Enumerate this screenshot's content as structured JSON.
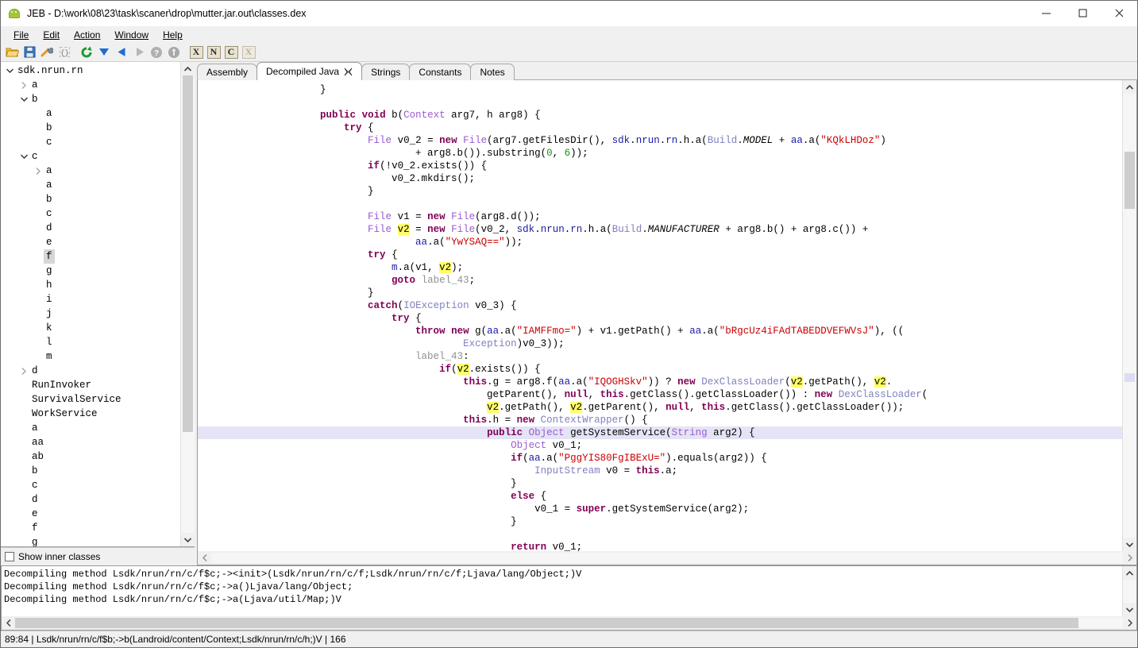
{
  "window": {
    "title": "JEB - D:\\work\\08\\23\\task\\scaner\\drop\\mutter.jar.out\\classes.dex",
    "icon": "android-robot-icon",
    "minimize": "—",
    "maximize": "□",
    "close": "✕"
  },
  "menu": [
    {
      "label": "File"
    },
    {
      "label": "Edit"
    },
    {
      "label": "Action"
    },
    {
      "label": "Window"
    },
    {
      "label": "Help"
    }
  ],
  "toolbar": {
    "buttons": [
      {
        "name": "open-folder-icon",
        "tip": "Open"
      },
      {
        "name": "save-icon",
        "tip": "Save"
      },
      {
        "name": "wrench-icon",
        "tip": "Options"
      },
      {
        "name": "braces-icon",
        "tip": "Decompile"
      },
      {
        "name": "refresh-icon",
        "tip": "Refresh"
      },
      {
        "name": "down-arrow-icon",
        "tip": "Forward"
      },
      {
        "name": "left-arrow-icon",
        "tip": "Back"
      },
      {
        "name": "right-arrow-icon",
        "tip": "Next"
      },
      {
        "name": "help-icon",
        "tip": "Help"
      },
      {
        "name": "info-icon",
        "tip": "About"
      }
    ],
    "letter_buttons": [
      {
        "label": "X",
        "disabled": false
      },
      {
        "label": "N",
        "disabled": false
      },
      {
        "label": "C",
        "disabled": false
      },
      {
        "label": "X",
        "disabled": true
      }
    ]
  },
  "tree": {
    "root": "sdk.nrun.rn",
    "selected": "f",
    "items": [
      {
        "label": "sdk.nrun.rn",
        "depth": 0,
        "twisty": "down"
      },
      {
        "label": "a",
        "depth": 1,
        "twisty": "right"
      },
      {
        "label": "b",
        "depth": 1,
        "twisty": "down"
      },
      {
        "label": "a",
        "depth": 2,
        "twisty": "none"
      },
      {
        "label": "b",
        "depth": 2,
        "twisty": "none"
      },
      {
        "label": "c",
        "depth": 2,
        "twisty": "none"
      },
      {
        "label": "c",
        "depth": 1,
        "twisty": "down"
      },
      {
        "label": "a",
        "depth": 2,
        "twisty": "right"
      },
      {
        "label": "a",
        "depth": 2,
        "twisty": "none"
      },
      {
        "label": "b",
        "depth": 2,
        "twisty": "none"
      },
      {
        "label": "c",
        "depth": 2,
        "twisty": "none"
      },
      {
        "label": "d",
        "depth": 2,
        "twisty": "none"
      },
      {
        "label": "e",
        "depth": 2,
        "twisty": "none"
      },
      {
        "label": "f",
        "depth": 2,
        "twisty": "none",
        "selected": true
      },
      {
        "label": "g",
        "depth": 2,
        "twisty": "none"
      },
      {
        "label": "h",
        "depth": 2,
        "twisty": "none"
      },
      {
        "label": "i",
        "depth": 2,
        "twisty": "none"
      },
      {
        "label": "j",
        "depth": 2,
        "twisty": "none"
      },
      {
        "label": "k",
        "depth": 2,
        "twisty": "none"
      },
      {
        "label": "l",
        "depth": 2,
        "twisty": "none"
      },
      {
        "label": "m",
        "depth": 2,
        "twisty": "none"
      },
      {
        "label": "d",
        "depth": 1,
        "twisty": "right"
      },
      {
        "label": "RunInvoker",
        "depth": 1,
        "twisty": "none"
      },
      {
        "label": "SurvivalService",
        "depth": 1,
        "twisty": "none"
      },
      {
        "label": "WorkService",
        "depth": 1,
        "twisty": "none"
      },
      {
        "label": "a",
        "depth": 1,
        "twisty": "none"
      },
      {
        "label": "aa",
        "depth": 1,
        "twisty": "none"
      },
      {
        "label": "ab",
        "depth": 1,
        "twisty": "none"
      },
      {
        "label": "b",
        "depth": 1,
        "twisty": "none"
      },
      {
        "label": "c",
        "depth": 1,
        "twisty": "none"
      },
      {
        "label": "d",
        "depth": 1,
        "twisty": "none"
      },
      {
        "label": "e",
        "depth": 1,
        "twisty": "none"
      },
      {
        "label": "f",
        "depth": 1,
        "twisty": "none"
      },
      {
        "label": "g",
        "depth": 1,
        "twisty": "none"
      }
    ],
    "show_inner_classes": {
      "label": "Show inner classes",
      "checked": false
    }
  },
  "tabs": [
    {
      "label": "Assembly",
      "active": false,
      "closable": false
    },
    {
      "label": "Decompiled Java",
      "active": true,
      "closable": true
    },
    {
      "label": "Strings",
      "active": false,
      "closable": false
    },
    {
      "label": "Constants",
      "active": false,
      "closable": false
    },
    {
      "label": "Notes",
      "active": false,
      "closable": false
    }
  ],
  "editor": {
    "highlighted_token": "v2",
    "highlighted_line_index": 27,
    "lines": [
      "                    }",
      "",
      "                    public void b(Context arg7, h arg8) {",
      "                        try {",
      "                            File v0_2 = new File(arg7.getFilesDir(), sdk.nrun.rn.h.a(Build.MODEL + aa.a(\"KQkLHDoz\")",
      "                                    + arg8.b()).substring(0, 6));",
      "                            if(!v0_2.exists()) {",
      "                                v0_2.mkdirs();",
      "                            }",
      "",
      "                            File v1 = new File(arg8.d());",
      "                            File v2 = new File(v0_2, sdk.nrun.rn.h.a(Build.MANUFACTURER + arg8.b() + arg8.c()) +",
      "                                    aa.a(\"YwYSAQ==\"));",
      "                            try {",
      "                                m.a(v1, v2);",
      "                                goto label_43;",
      "                            }",
      "                            catch(IOException v0_3) {",
      "                                try {",
      "                                    throw new g(aa.a(\"IAMFFmo=\") + v1.getPath() + aa.a(\"bRgcUz4iFAdTABEDDVEFWVsJ\"), ((",
      "                                            Exception)v0_3));",
      "                                    label_43:",
      "                                        if(v2.exists()) {",
      "                                            this.g = arg8.f(aa.a(\"IQOGHSkv\")) ? new DexClassLoader(v2.getPath(), v2.",
      "                                                getParent(), null, this.getClass().getClassLoader()) : new DexClassLoader(",
      "                                                v2.getPath(), v2.getParent(), null, this.getClass().getClassLoader());",
      "                                            this.h = new ContextWrapper() {",
      "                                                public Object getSystemService(String arg2) {",
      "                                                    Object v0_1;",
      "                                                    if(aa.a(\"PggYIS80FgIBExU=\").equals(arg2)) {",
      "                                                        InputStream v0 = this.a;",
      "                                                    }",
      "                                                    else {",
      "                                                        v0_1 = super.getSystemService(arg2);",
      "                                                    }",
      "",
      "                                                    return v0_1;"
    ]
  },
  "log": {
    "lines": [
      "Decompiling method Lsdk/nrun/rn/c/f$c;-><init>(Lsdk/nrun/rn/c/f;Lsdk/nrun/rn/c/f;Ljava/lang/Object;)V",
      "Decompiling method Lsdk/nrun/rn/c/f$c;->a()Ljava/lang/Object;",
      "Decompiling method Lsdk/nrun/rn/c/f$c;->a(Ljava/util/Map;)V"
    ]
  },
  "statusbar": {
    "text": "89:84  |  Lsdk/nrun/rn/c/f$b;->b(Landroid/content/Context;Lsdk/nrun/rn/c/h;)V  |  166"
  },
  "colors": {
    "keyword": "#7f0055",
    "type": "#9b59d0",
    "string": "#cc0000",
    "number": "#149414",
    "identifier": "#1a1aa8",
    "class": "#8080c0",
    "line_highlight": "#e4e4f6",
    "token_highlight": "#ffff66",
    "selection": "#d6d6d6"
  }
}
